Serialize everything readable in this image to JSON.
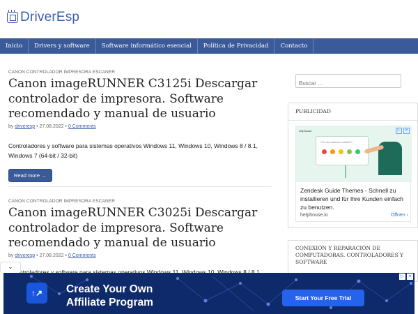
{
  "header": {
    "logo_text": "DriverEsp",
    "logo_icon": "chip-icon"
  },
  "nav": {
    "items": [
      {
        "label": "Inicio"
      },
      {
        "label": "Drivers y software"
      },
      {
        "label": "Software informático esencial"
      },
      {
        "label": "Política de Privacidad"
      },
      {
        "label": "Contacto"
      }
    ]
  },
  "posts": [
    {
      "category": "CANON CONTROLADOR IMPRESORA ESCANER",
      "title": "Canon imageRUNNER C3125i Descargar controlador de impresora. Software recomendado y manual de usuario",
      "by": "by",
      "author": "driveresp",
      "sep1": "•",
      "date": "27.08.2022",
      "sep2": "•",
      "comments": "0 Comments",
      "excerpt": "Controladores y software para sistemas operativos Windows 11, Windows 10, Windows 8 / 8.1, Windows 7 (64-bit / 32-bit)",
      "read_more": "Read more →"
    },
    {
      "category": "CANON CONTROLADOR IMPRESORA ESCANER",
      "title": "Canon imageRUNNER C3025i Descargar controlador de impresora. Software recomendado y manual de usuario",
      "by": "by",
      "author": "driveresp",
      "sep1": "•",
      "date": "27.08.2022",
      "sep2": "•",
      "comments": "0 Comments",
      "excerpt": "ntroladores y software para sistemas operativos Windows 11, Windows 10, Windows 8 / 8.1,"
    }
  ],
  "sidebar": {
    "search_placeholder": "Buscar …",
    "ads_title": "PUBLICIDAD",
    "ad": {
      "brand": "helphouse",
      "screen_question": "How are customers satisfied?",
      "text": "Zendesk Guide Themes - Schnell zu installieren und für Ihre Kunden einfach zu benutzen.",
      "domain": "helphouse.io",
      "open_label": "Öffnen",
      "open_icon": "chevron-right-icon",
      "badge_info": "▷",
      "badge_close": "✕"
    },
    "services_title": "CONEXIÓN Y REPARACIÓN DE COMPUTADORAS. CONTROLADORES Y SOFTWARE"
  },
  "bottom_ad": {
    "headline": "Create Your Own Affiliate Program",
    "cta": "Start Your Free Trial",
    "logo_glyph": "↑↗",
    "badge_info": "▷",
    "badge_close": "✕",
    "collapse_icon": "chevron-down-icon"
  },
  "colors": {
    "nav": "#3b5a9a",
    "brand": "#3b5ea8",
    "ad_bg": "#0f2a6b",
    "cta": "#2563eb"
  }
}
